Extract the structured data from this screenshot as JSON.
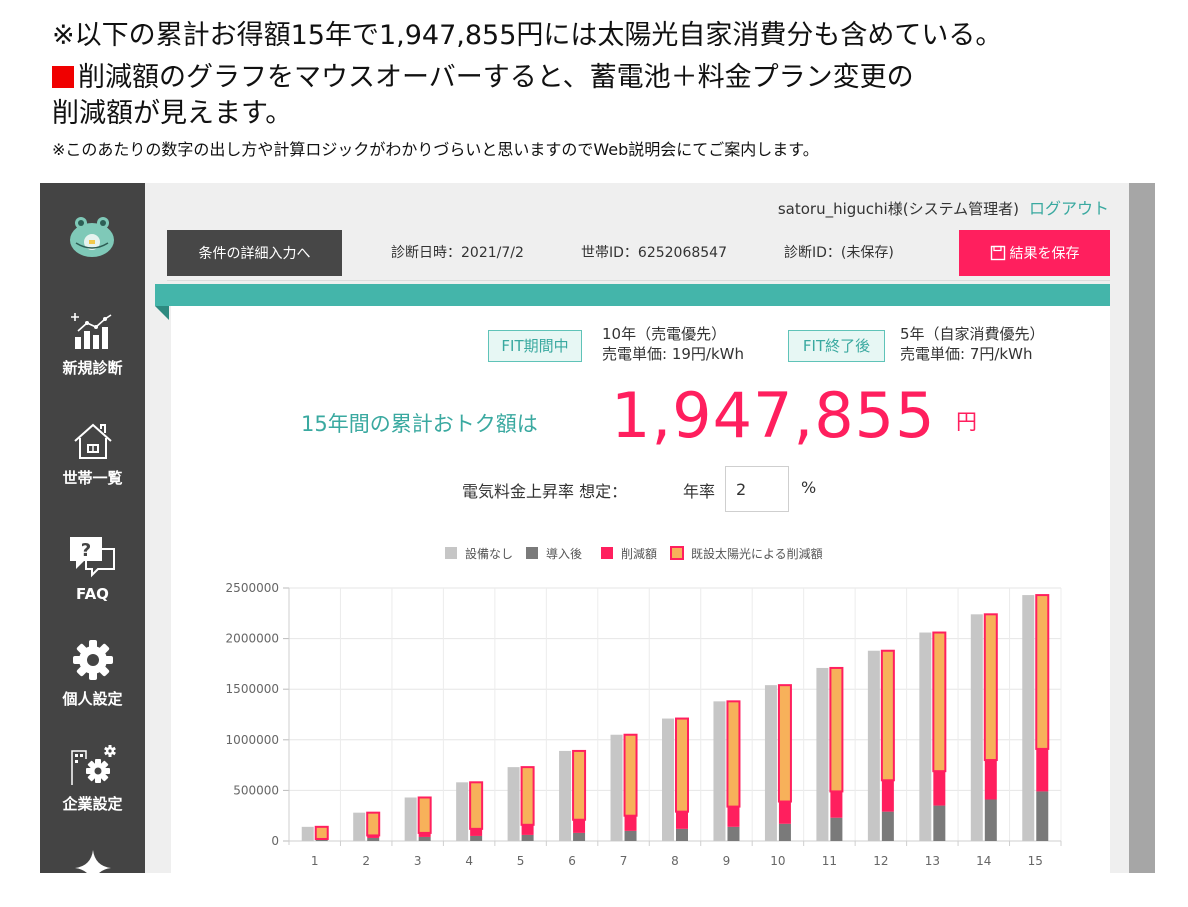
{
  "notes": {
    "line1": "※以下の累計お得額15年で1,947,855円には太陽光自家消費分も含めている。",
    "line2": "削減額のグラフをマウスオーバーすると、蓄電池＋料金プラン変更の",
    "line3": "削減額が見えます。",
    "line4": "※このあたりの数字の出し方や計算ロジックがわかりづらいと思いますのでWeb説明会にてご案内します。"
  },
  "sidebar": {
    "items": [
      {
        "label": "新規診断",
        "icon": "bar-chart-icon"
      },
      {
        "label": "世帯一覧",
        "icon": "house-icon"
      },
      {
        "label": "FAQ",
        "icon": "question-bubble-icon"
      },
      {
        "label": "個人設定",
        "icon": "gear-icon"
      },
      {
        "label": "企業設定",
        "icon": "company-gear-icon"
      },
      {
        "label": "",
        "icon": "sparkle-icon"
      }
    ]
  },
  "header": {
    "user": "satoru_higuchi様(システム管理者)",
    "logout": "ログアウト",
    "detail_button": "条件の詳細入力へ",
    "date": "診断日時：2021/7/2",
    "household_id": "世帯ID：6252068547",
    "diagnosis_id": "診断ID：(未保存)",
    "save_button": "結果を保存"
  },
  "fit": {
    "during_tag": "FIT期間中",
    "during_line1": "10年（売電優先）",
    "during_line2": "売電単価: 19円/kWh",
    "after_tag": "FIT終了後",
    "after_line1": "5年（自家消費優先）",
    "after_line2": "売電単価: 7円/kWh"
  },
  "summary": {
    "label": "15年間の累計おトク額は",
    "value": "1,947,855",
    "unit": "円"
  },
  "rate": {
    "label": "電気料金上昇率 想定：",
    "year_label": "年率",
    "value": "2",
    "unit": "%"
  },
  "colors": {
    "accent_teal": "#44b5aa",
    "accent_pink": "#ff1f5e",
    "sidebar_bg": "#444444",
    "series_none": "#c6c6c6",
    "series_after": "#7a7a7a",
    "series_reduction": "#ff1f5e",
    "series_solar": "#f7b15a"
  },
  "chart_data": {
    "type": "bar",
    "categories": [
      "1",
      "2",
      "3",
      "4",
      "5",
      "6",
      "7",
      "8",
      "9",
      "10",
      "11",
      "12",
      "13",
      "14",
      "15"
    ],
    "y_ticks": [
      "0",
      "500000",
      "1000000",
      "1500000",
      "2000000",
      "2500000"
    ],
    "ylim": [
      0,
      2500000
    ],
    "grid": true,
    "legend_position": "top",
    "series": [
      {
        "name": "設備なし",
        "values": [
          140000,
          280000,
          430000,
          580000,
          730000,
          890000,
          1050000,
          1210000,
          1380000,
          1540000,
          1710000,
          1880000,
          2060000,
          2240000,
          2430000
        ]
      },
      {
        "name": "導入後",
        "values": [
          10000,
          30000,
          40000,
          50000,
          60000,
          80000,
          100000,
          120000,
          140000,
          170000,
          230000,
          290000,
          350000,
          410000,
          490000
        ]
      },
      {
        "name": "削減額",
        "values": [
          10000,
          25000,
          40000,
          70000,
          100000,
          130000,
          150000,
          170000,
          200000,
          220000,
          260000,
          310000,
          340000,
          390000,
          420000
        ]
      },
      {
        "name": "既設太陽光による削減額",
        "values": [
          120000,
          225000,
          350000,
          460000,
          570000,
          680000,
          800000,
          920000,
          1040000,
          1150000,
          1220000,
          1280000,
          1370000,
          1440000,
          1520000
        ]
      }
    ]
  }
}
